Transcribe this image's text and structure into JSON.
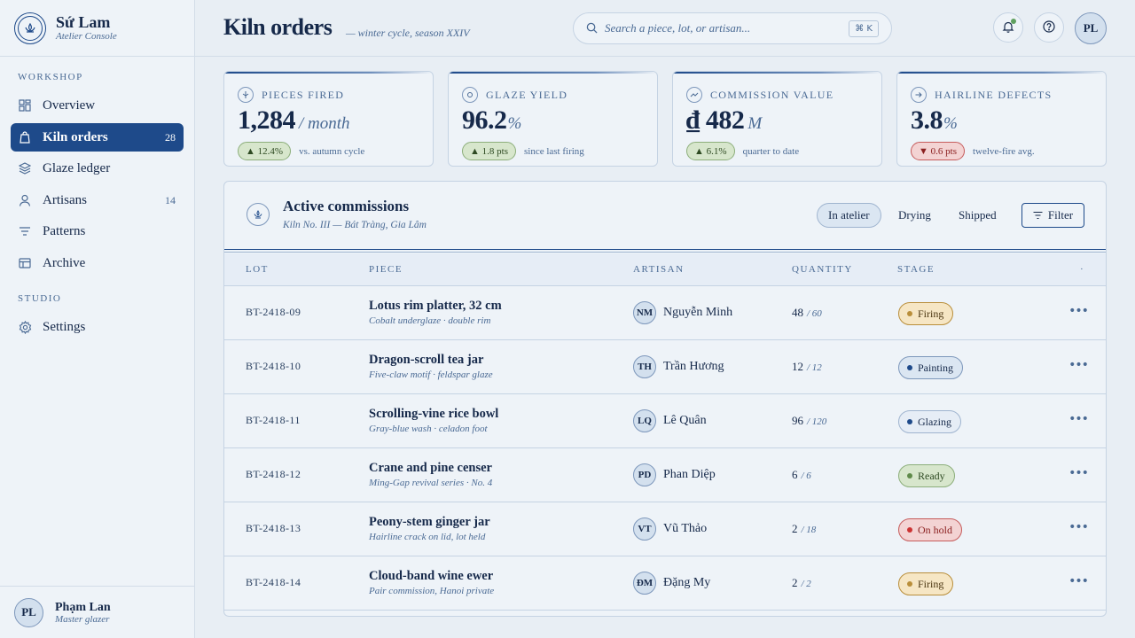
{
  "brand": {
    "name": "Sứ Lam",
    "subtitle": "Atelier Console"
  },
  "nav": {
    "workshop_label": "WORKSHOP",
    "studio_label": "STUDIO",
    "items": [
      {
        "label": "Overview",
        "icon": "grid-icon"
      },
      {
        "label": "Kiln orders",
        "icon": "bag-icon",
        "badge": "28",
        "active": true
      },
      {
        "label": "Glaze ledger",
        "icon": "layers-icon"
      },
      {
        "label": "Artisans",
        "icon": "person-icon",
        "badge": "14"
      },
      {
        "label": "Patterns",
        "icon": "lines-icon"
      },
      {
        "label": "Archive",
        "icon": "table-icon"
      },
      {
        "label": "Settings",
        "icon": "gear-icon"
      }
    ]
  },
  "user": {
    "initials": "PL",
    "name": "Phạm Lan",
    "role": "Master glazer"
  },
  "header": {
    "title": "Kiln orders",
    "subtitle": "— winter cycle, season XXIV",
    "search_placeholder": "Search a piece, lot, or artisan...",
    "shortcut": "⌘ K",
    "avatar_initials": "PL"
  },
  "stats": [
    {
      "label": "PIECES FIRED",
      "value": "1,284",
      "unit": "/ month",
      "delta": "▲ 12.4%",
      "direction": "up",
      "note": "vs. autumn cycle"
    },
    {
      "label": "GLAZE YIELD",
      "value": "96.2",
      "unit": "%",
      "delta": "▲ 1.8 pts",
      "direction": "up",
      "note": "since last firing"
    },
    {
      "label": "COMMISSION VALUE",
      "value": "₫ 482",
      "unit": "M",
      "delta": "▲ 6.1%",
      "direction": "up",
      "note": "quarter to date"
    },
    {
      "label": "HAIRLINE DEFECTS",
      "value": "3.8",
      "unit": "%",
      "delta": "▼ 0.6 pts",
      "direction": "down",
      "note": "twelve-fire avg."
    }
  ],
  "panel": {
    "title": "Active commissions",
    "subtitle": "Kiln No. III — Bát Tràng, Gia Lâm",
    "segments": [
      "In atelier",
      "Drying",
      "Shipped"
    ],
    "filter_label": "Filter"
  },
  "table": {
    "columns": [
      "LOT",
      "PIECE",
      "ARTISAN",
      "QUANTITY",
      "STAGE",
      "·"
    ],
    "rows": [
      {
        "lot": "BT-2418-09",
        "piece": "Lotus rim platter, 32 cm",
        "note": "Cobalt underglaze · double rim",
        "initials": "NM",
        "artisan": "Nguyễn Minh",
        "qty": "48",
        "qty_total": "/ 60",
        "stage": "Firing",
        "stage_type": "firing"
      },
      {
        "lot": "BT-2418-10",
        "piece": "Dragon-scroll tea jar",
        "note": "Five-claw motif · feldspar glaze",
        "initials": "TH",
        "artisan": "Trần Hương",
        "qty": "12",
        "qty_total": "/ 12",
        "stage": "Painting",
        "stage_type": "painting"
      },
      {
        "lot": "BT-2418-11",
        "piece": "Scrolling-vine rice bowl",
        "note": "Gray-blue wash · celadon foot",
        "initials": "LQ",
        "artisan": "Lê Quân",
        "qty": "96",
        "qty_total": "/ 120",
        "stage": "Glazing",
        "stage_type": "glazing"
      },
      {
        "lot": "BT-2418-12",
        "piece": "Crane and pine censer",
        "note": "Ming-Gap revival series · No. 4",
        "initials": "PD",
        "artisan": "Phan Diệp",
        "qty": "6",
        "qty_total": "/ 6",
        "stage": "Ready",
        "stage_type": "ready"
      },
      {
        "lot": "BT-2418-13",
        "piece": "Peony-stem ginger jar",
        "note": "Hairline crack on lid, lot held",
        "initials": "VT",
        "artisan": "Vũ Thảo",
        "qty": "2",
        "qty_total": "/ 18",
        "stage": "On hold",
        "stage_type": "hold"
      },
      {
        "lot": "BT-2418-14",
        "piece": "Cloud-band wine ewer",
        "note": "Pair commission, Hanoi private",
        "initials": "ĐM",
        "artisan": "Đặng My",
        "qty": "2",
        "qty_total": "/ 2",
        "stage": "Firing",
        "stage_type": "firing"
      }
    ]
  },
  "colors": {
    "accent": "#1e4a8a",
    "background": "#e8eef4",
    "surface": "#eef3f8"
  }
}
